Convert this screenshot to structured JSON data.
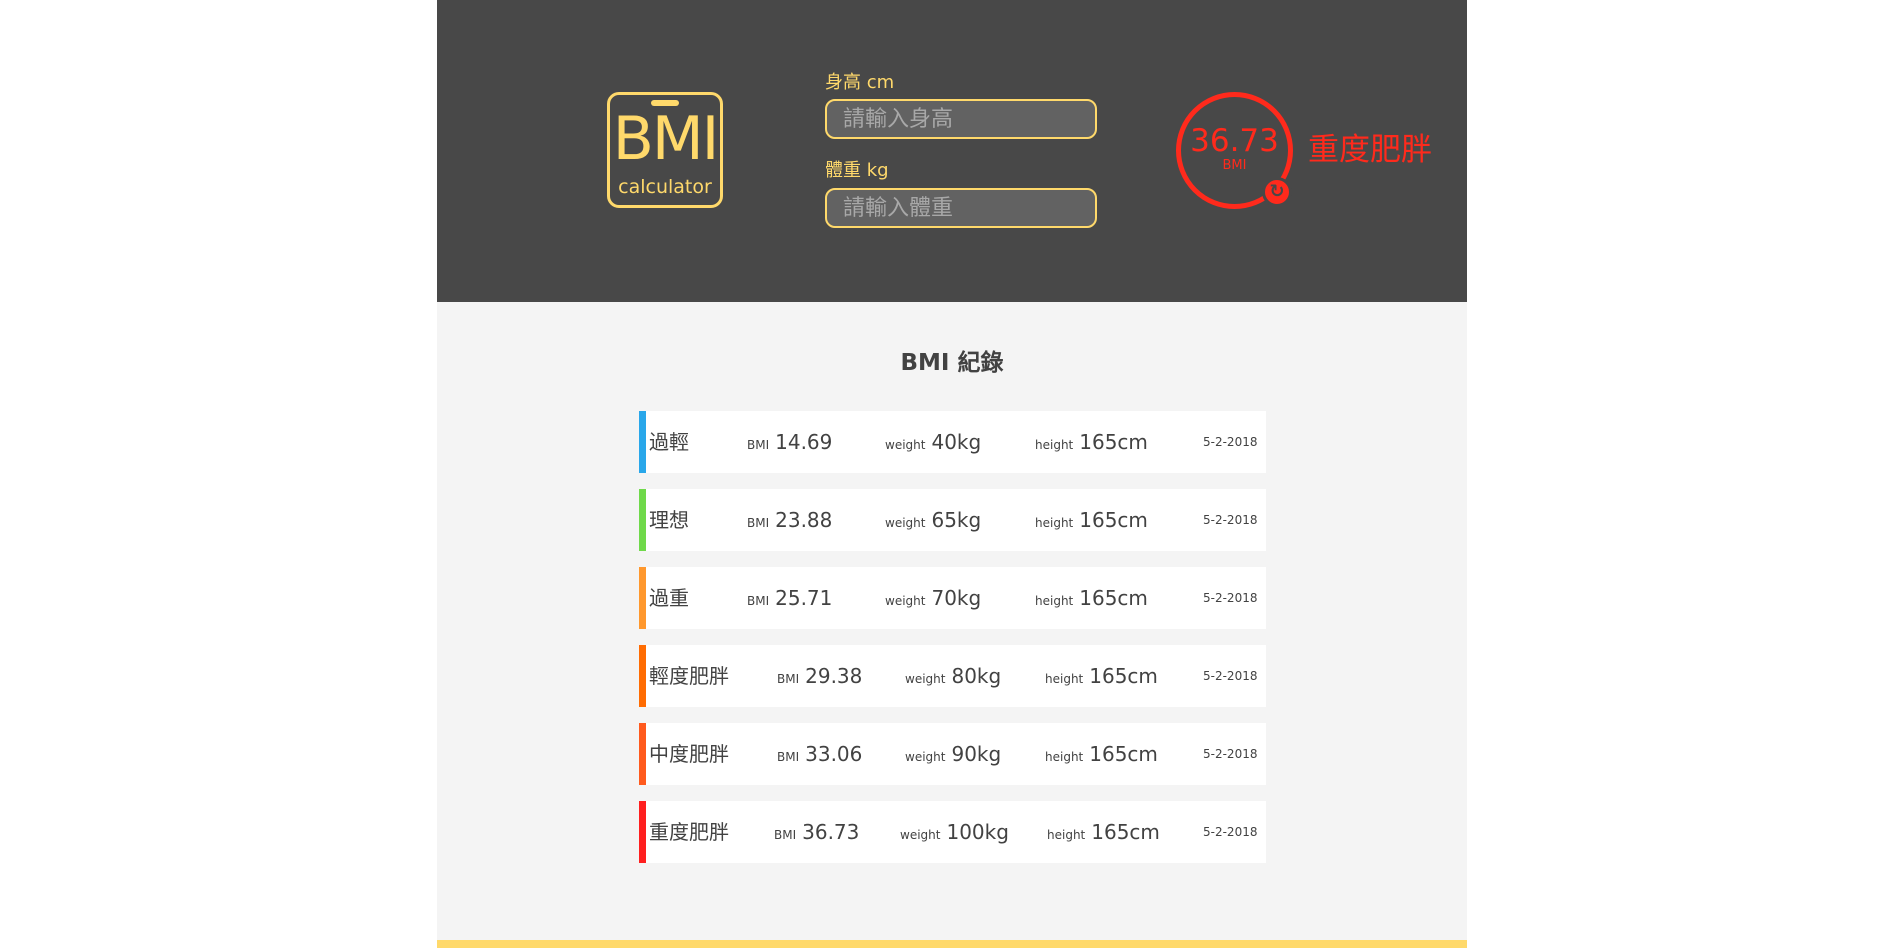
{
  "logo": {
    "main": "BMI",
    "sub": "calculator"
  },
  "height_field": {
    "label": "身高 cm",
    "placeholder": "請輸入身高"
  },
  "weight_field": {
    "label": "體重 kg",
    "placeholder": "請輸入體重"
  },
  "result": {
    "value": "36.73",
    "unit": "BMI",
    "status": "重度肥胖",
    "color": "#ff2a1c",
    "reset_icon": "refresh-icon"
  },
  "records_title": "BMI 紀錄",
  "records": [
    {
      "status": "過輕",
      "bmi_label": "BMI",
      "bmi": "14.69",
      "weight_label": "weight",
      "weight": "40kg",
      "height_label": "height",
      "height": "165cm",
      "date": "5-2-2018",
      "color": "#29a7ea"
    },
    {
      "status": "理想",
      "bmi_label": "BMI",
      "bmi": "23.88",
      "weight_label": "weight",
      "weight": "65kg",
      "height_label": "height",
      "height": "165cm",
      "date": "5-2-2018",
      "color": "#6fd94a"
    },
    {
      "status": "過重",
      "bmi_label": "BMI",
      "bmi": "25.71",
      "weight_label": "weight",
      "weight": "70kg",
      "height_label": "height",
      "height": "165cm",
      "date": "5-2-2018",
      "color": "#ff982d"
    },
    {
      "status": "輕度肥胖",
      "bmi_label": "BMI",
      "bmi": "29.38",
      "weight_label": "weight",
      "weight": "80kg",
      "height_label": "height",
      "height": "165cm",
      "date": "5-2-2018",
      "color": "#ff6c02"
    },
    {
      "status": "中度肥胖",
      "bmi_label": "BMI",
      "bmi": "33.06",
      "weight_label": "weight",
      "weight": "90kg",
      "height_label": "height",
      "height": "165cm",
      "date": "5-2-2018",
      "color": "#ff5a1d"
    },
    {
      "status": "重度肥胖",
      "bmi_label": "BMI",
      "bmi": "36.73",
      "weight_label": "weight",
      "weight": "100kg",
      "height_label": "height",
      "height": "165cm",
      "date": "5-2-2018",
      "color": "#ff1f1f"
    }
  ],
  "colors": {
    "header_bg": "#484848",
    "accent": "#ffd96b",
    "content_bg": "#f4f4f4"
  }
}
